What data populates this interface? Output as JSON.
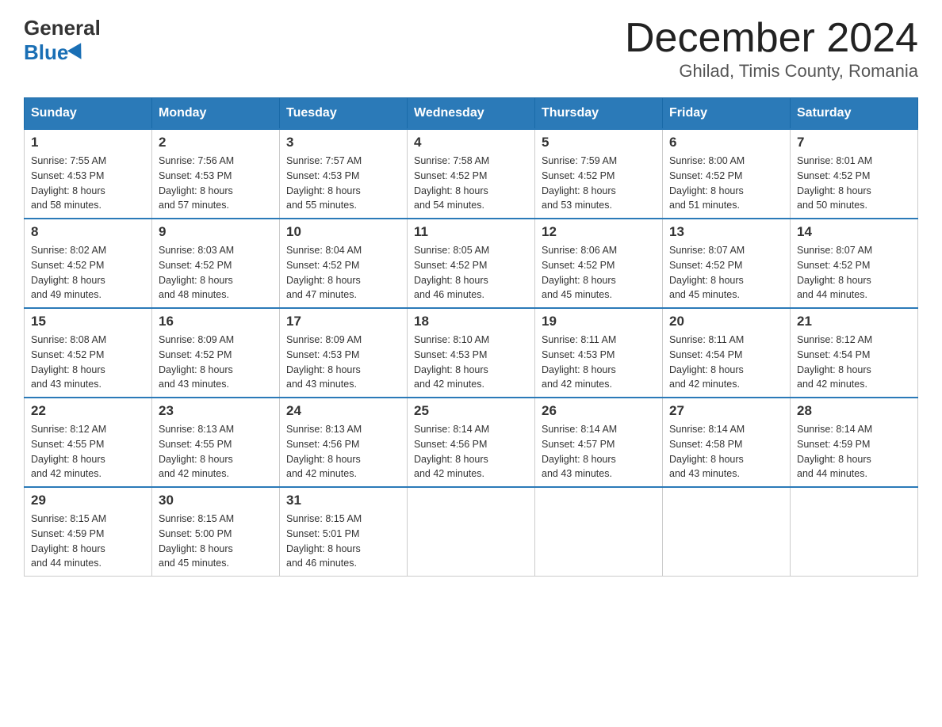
{
  "logo": {
    "general": "General",
    "blue": "Blue"
  },
  "title": {
    "month_year": "December 2024",
    "location": "Ghilad, Timis County, Romania"
  },
  "header_days": [
    "Sunday",
    "Monday",
    "Tuesday",
    "Wednesday",
    "Thursday",
    "Friday",
    "Saturday"
  ],
  "weeks": [
    [
      {
        "day": "1",
        "sunrise": "7:55 AM",
        "sunset": "4:53 PM",
        "daylight": "8 hours and 58 minutes."
      },
      {
        "day": "2",
        "sunrise": "7:56 AM",
        "sunset": "4:53 PM",
        "daylight": "8 hours and 57 minutes."
      },
      {
        "day": "3",
        "sunrise": "7:57 AM",
        "sunset": "4:53 PM",
        "daylight": "8 hours and 55 minutes."
      },
      {
        "day": "4",
        "sunrise": "7:58 AM",
        "sunset": "4:52 PM",
        "daylight": "8 hours and 54 minutes."
      },
      {
        "day": "5",
        "sunrise": "7:59 AM",
        "sunset": "4:52 PM",
        "daylight": "8 hours and 53 minutes."
      },
      {
        "day": "6",
        "sunrise": "8:00 AM",
        "sunset": "4:52 PM",
        "daylight": "8 hours and 51 minutes."
      },
      {
        "day": "7",
        "sunrise": "8:01 AM",
        "sunset": "4:52 PM",
        "daylight": "8 hours and 50 minutes."
      }
    ],
    [
      {
        "day": "8",
        "sunrise": "8:02 AM",
        "sunset": "4:52 PM",
        "daylight": "8 hours and 49 minutes."
      },
      {
        "day": "9",
        "sunrise": "8:03 AM",
        "sunset": "4:52 PM",
        "daylight": "8 hours and 48 minutes."
      },
      {
        "day": "10",
        "sunrise": "8:04 AM",
        "sunset": "4:52 PM",
        "daylight": "8 hours and 47 minutes."
      },
      {
        "day": "11",
        "sunrise": "8:05 AM",
        "sunset": "4:52 PM",
        "daylight": "8 hours and 46 minutes."
      },
      {
        "day": "12",
        "sunrise": "8:06 AM",
        "sunset": "4:52 PM",
        "daylight": "8 hours and 45 minutes."
      },
      {
        "day": "13",
        "sunrise": "8:07 AM",
        "sunset": "4:52 PM",
        "daylight": "8 hours and 45 minutes."
      },
      {
        "day": "14",
        "sunrise": "8:07 AM",
        "sunset": "4:52 PM",
        "daylight": "8 hours and 44 minutes."
      }
    ],
    [
      {
        "day": "15",
        "sunrise": "8:08 AM",
        "sunset": "4:52 PM",
        "daylight": "8 hours and 43 minutes."
      },
      {
        "day": "16",
        "sunrise": "8:09 AM",
        "sunset": "4:52 PM",
        "daylight": "8 hours and 43 minutes."
      },
      {
        "day": "17",
        "sunrise": "8:09 AM",
        "sunset": "4:53 PM",
        "daylight": "8 hours and 43 minutes."
      },
      {
        "day": "18",
        "sunrise": "8:10 AM",
        "sunset": "4:53 PM",
        "daylight": "8 hours and 42 minutes."
      },
      {
        "day": "19",
        "sunrise": "8:11 AM",
        "sunset": "4:53 PM",
        "daylight": "8 hours and 42 minutes."
      },
      {
        "day": "20",
        "sunrise": "8:11 AM",
        "sunset": "4:54 PM",
        "daylight": "8 hours and 42 minutes."
      },
      {
        "day": "21",
        "sunrise": "8:12 AM",
        "sunset": "4:54 PM",
        "daylight": "8 hours and 42 minutes."
      }
    ],
    [
      {
        "day": "22",
        "sunrise": "8:12 AM",
        "sunset": "4:55 PM",
        "daylight": "8 hours and 42 minutes."
      },
      {
        "day": "23",
        "sunrise": "8:13 AM",
        "sunset": "4:55 PM",
        "daylight": "8 hours and 42 minutes."
      },
      {
        "day": "24",
        "sunrise": "8:13 AM",
        "sunset": "4:56 PM",
        "daylight": "8 hours and 42 minutes."
      },
      {
        "day": "25",
        "sunrise": "8:14 AM",
        "sunset": "4:56 PM",
        "daylight": "8 hours and 42 minutes."
      },
      {
        "day": "26",
        "sunrise": "8:14 AM",
        "sunset": "4:57 PM",
        "daylight": "8 hours and 43 minutes."
      },
      {
        "day": "27",
        "sunrise": "8:14 AM",
        "sunset": "4:58 PM",
        "daylight": "8 hours and 43 minutes."
      },
      {
        "day": "28",
        "sunrise": "8:14 AM",
        "sunset": "4:59 PM",
        "daylight": "8 hours and 44 minutes."
      }
    ],
    [
      {
        "day": "29",
        "sunrise": "8:15 AM",
        "sunset": "4:59 PM",
        "daylight": "8 hours and 44 minutes."
      },
      {
        "day": "30",
        "sunrise": "8:15 AM",
        "sunset": "5:00 PM",
        "daylight": "8 hours and 45 minutes."
      },
      {
        "day": "31",
        "sunrise": "8:15 AM",
        "sunset": "5:01 PM",
        "daylight": "8 hours and 46 minutes."
      },
      null,
      null,
      null,
      null
    ]
  ]
}
